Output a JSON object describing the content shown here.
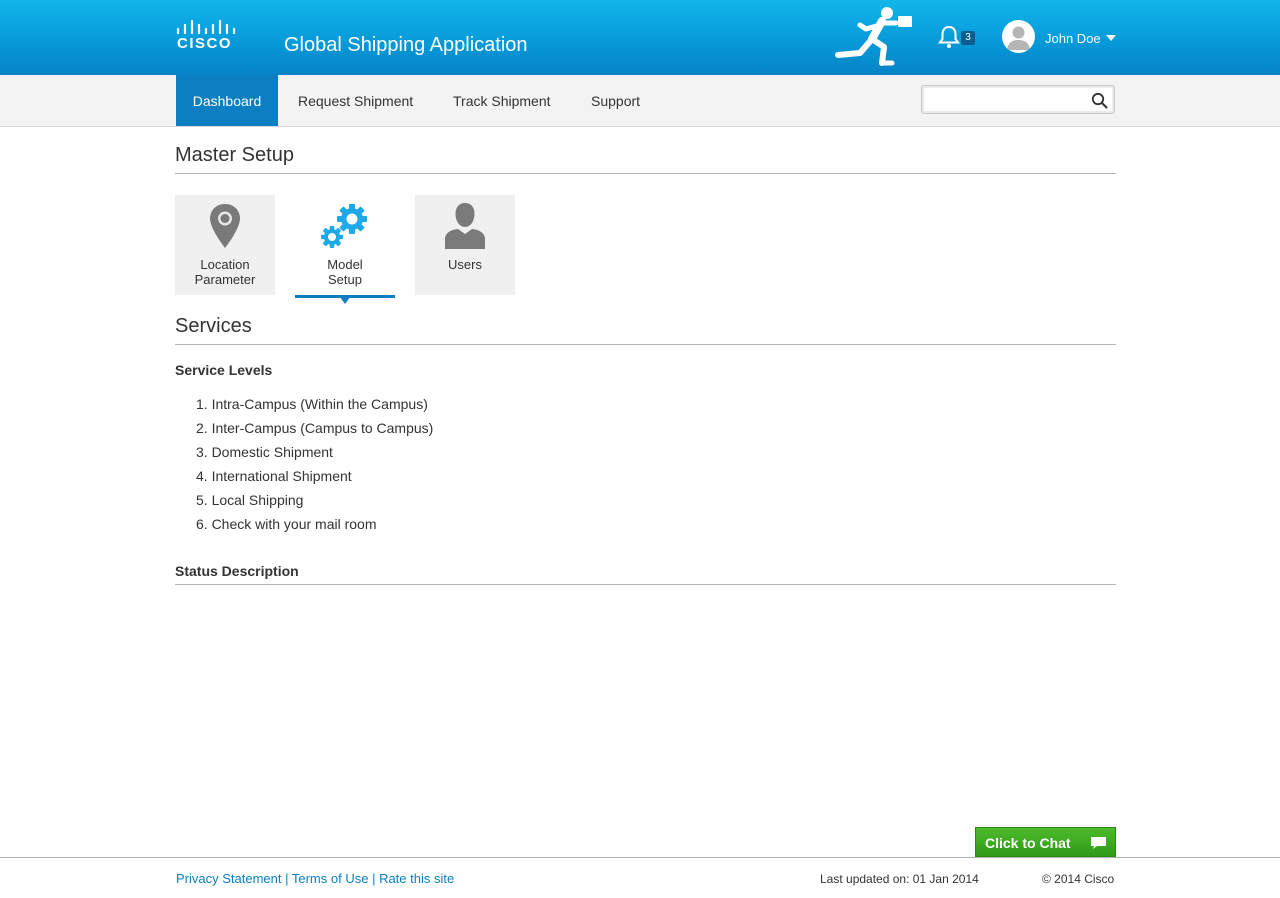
{
  "header": {
    "logo_text": "CISCO",
    "app_title": "Global Shipping Application",
    "notifications_count": "3",
    "user_name": "John Doe",
    "brand_color": "#079ad9"
  },
  "nav": {
    "items": [
      {
        "label": "Dashboard",
        "active": true
      },
      {
        "label": "Request Shipment"
      },
      {
        "label": "Track Shipment"
      },
      {
        "label": "Support"
      }
    ],
    "search": {
      "value": "",
      "placeholder": ""
    }
  },
  "master_setup": {
    "title": "Master Setup",
    "tiles": [
      {
        "label_line1": "Location",
        "label_line2": "Parameter",
        "icon": "location-pin-icon"
      },
      {
        "label_line1": "Model",
        "label_line2": "Setup",
        "icon": "gears-icon",
        "active": true
      },
      {
        "label_line1": "Users",
        "icon": "user-icon"
      }
    ]
  },
  "services": {
    "title": "Services",
    "service_levels_heading": "Service Levels",
    "service_levels": [
      "1. Intra-Campus (Within the Campus)",
      "2. Inter-Campus (Campus to Campus)",
      "3. Domestic Shipment",
      "4. International Shipment",
      "5. Local Shipping",
      "6. Check with your mail room"
    ],
    "status_heading": "Status Description"
  },
  "chat": {
    "label": "Click to Chat",
    "color": "#3aa81f"
  },
  "footer": {
    "links": [
      "Privacy Statement",
      "Terms of Use",
      "Rate this site"
    ],
    "separator": " | ",
    "last_updated": "Last updated on: 01 Jan 2014",
    "copyright": "© 2014 Cisco"
  }
}
